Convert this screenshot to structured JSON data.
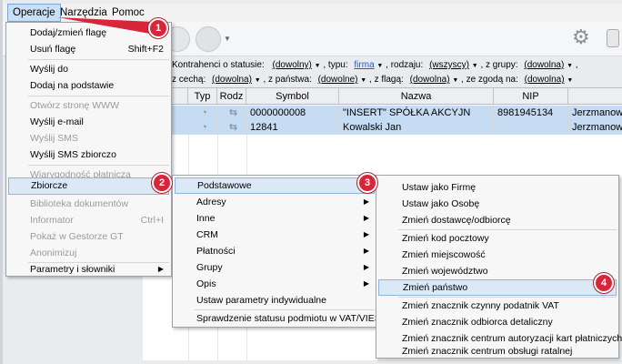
{
  "menubar": {
    "items": [
      {
        "label": "Operacje"
      },
      {
        "label": "Narzędzia"
      },
      {
        "label": "Pomoc"
      }
    ]
  },
  "filters": {
    "row1_prefix": "Kontrahenci o statusie:",
    "status_value": "(dowolny)",
    "type_label": ", typu:",
    "type_value": "firma",
    "kind_label": ", rodzaju:",
    "kind_value": "(wszyscy)",
    "group_label": ", z grupy:",
    "group_value": "(dowolna)",
    "row2_prefix": "z cechą:",
    "feature_value": "(dowolna)",
    "country_label": ", z państwa:",
    "country_value": "(dowolne)",
    "flag_label": ", z flagą:",
    "flag_value": "(dowolna)",
    "consent_label": ", ze zgodą na:",
    "consent_value": "(dowolna)"
  },
  "grid": {
    "columns": [
      "S",
      "Typ",
      "Rodz",
      "Symbol",
      "Nazwa",
      "NIP",
      ""
    ],
    "rows": [
      {
        "symbol": "0000000008",
        "name": "\"INSERT\" SPÓŁKA AKCYJN",
        "nip": "8981945134",
        "city": "Jerzmanow"
      },
      {
        "symbol": "12841",
        "name": "Kowalski Jan",
        "nip": "",
        "city": "Jerzmanow"
      }
    ]
  },
  "menu_operacje": {
    "items": [
      {
        "label": "Dodaj/zmień flagę",
        "shortcut": ""
      },
      {
        "label": "Usuń flagę",
        "shortcut": "Shift+F2"
      },
      {
        "label": "Wyślij do",
        "shortcut": ""
      },
      {
        "label": "Dodaj na podstawie",
        "shortcut": ""
      },
      {
        "label": "Otwórz stronę WWW",
        "shortcut": ""
      },
      {
        "label": "Wyślij e-mail",
        "shortcut": ""
      },
      {
        "label": "Wyślij SMS",
        "shortcut": ""
      },
      {
        "label": "Wyślij SMS zbiorczo",
        "shortcut": ""
      },
      {
        "label": "Wiarygodność płatnicza",
        "shortcut": ""
      },
      {
        "label": "Zbiorcze",
        "shortcut": ""
      },
      {
        "label": "Biblioteka dokumentów",
        "shortcut": ""
      },
      {
        "label": "Informator",
        "shortcut": "Ctrl+I"
      },
      {
        "label": "Pokaż w Gestorze GT",
        "shortcut": ""
      },
      {
        "label": "Anonimizuj",
        "shortcut": ""
      },
      {
        "label": "Parametry i słowniki",
        "shortcut": ""
      }
    ]
  },
  "menu_zbiorcze": {
    "items": [
      {
        "label": "Podstawowe"
      },
      {
        "label": "Adresy"
      },
      {
        "label": "Inne"
      },
      {
        "label": "CRM"
      },
      {
        "label": "Płatności"
      },
      {
        "label": "Grupy"
      },
      {
        "label": "Opis"
      },
      {
        "label": "Ustaw parametry indywidualne"
      },
      {
        "label": "Sprawdzenie statusu podmiotu w VAT/VIES"
      }
    ]
  },
  "menu_podstawowe": {
    "items": [
      {
        "label": "Ustaw jako Firmę"
      },
      {
        "label": "Ustaw jako Osobę"
      },
      {
        "label": "Zmień dostawcę/odbiorcę"
      },
      {
        "label": "Zmień kod pocztowy"
      },
      {
        "label": "Zmień miejscowość"
      },
      {
        "label": "Zmień województwo"
      },
      {
        "label": "Zmień państwo"
      },
      {
        "label": "Zmień znacznik czynny podatnik VAT"
      },
      {
        "label": "Zmień znacznik odbiorca detaliczny"
      },
      {
        "label": "Zmień znacznik centrum autoryzacji kart płatniczych"
      },
      {
        "label": "Zmień znacznik centrum obsługi ratalnej"
      }
    ]
  },
  "badges": [
    "1",
    "2",
    "3",
    "4"
  ],
  "colors": {
    "annotation": "#d7263a",
    "highlight": "#dbe8f6"
  }
}
